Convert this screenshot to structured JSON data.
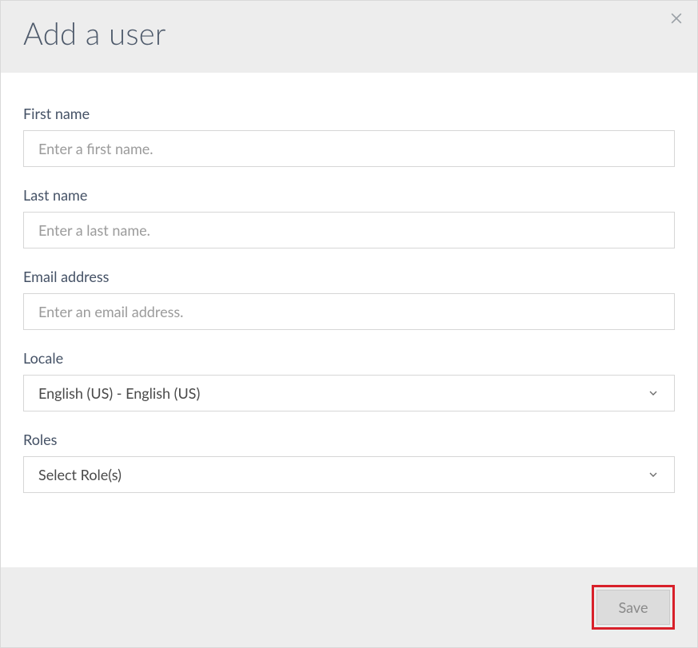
{
  "header": {
    "title": "Add a user"
  },
  "form": {
    "first_name": {
      "label": "First name",
      "placeholder": "Enter a first name.",
      "value": ""
    },
    "last_name": {
      "label": "Last name",
      "placeholder": "Enter a last name.",
      "value": ""
    },
    "email": {
      "label": "Email address",
      "placeholder": "Enter an email address.",
      "value": ""
    },
    "locale": {
      "label": "Locale",
      "selected": "English (US) - English (US)"
    },
    "roles": {
      "label": "Roles",
      "placeholder": "Select Role(s)"
    }
  },
  "footer": {
    "save_label": "Save"
  }
}
